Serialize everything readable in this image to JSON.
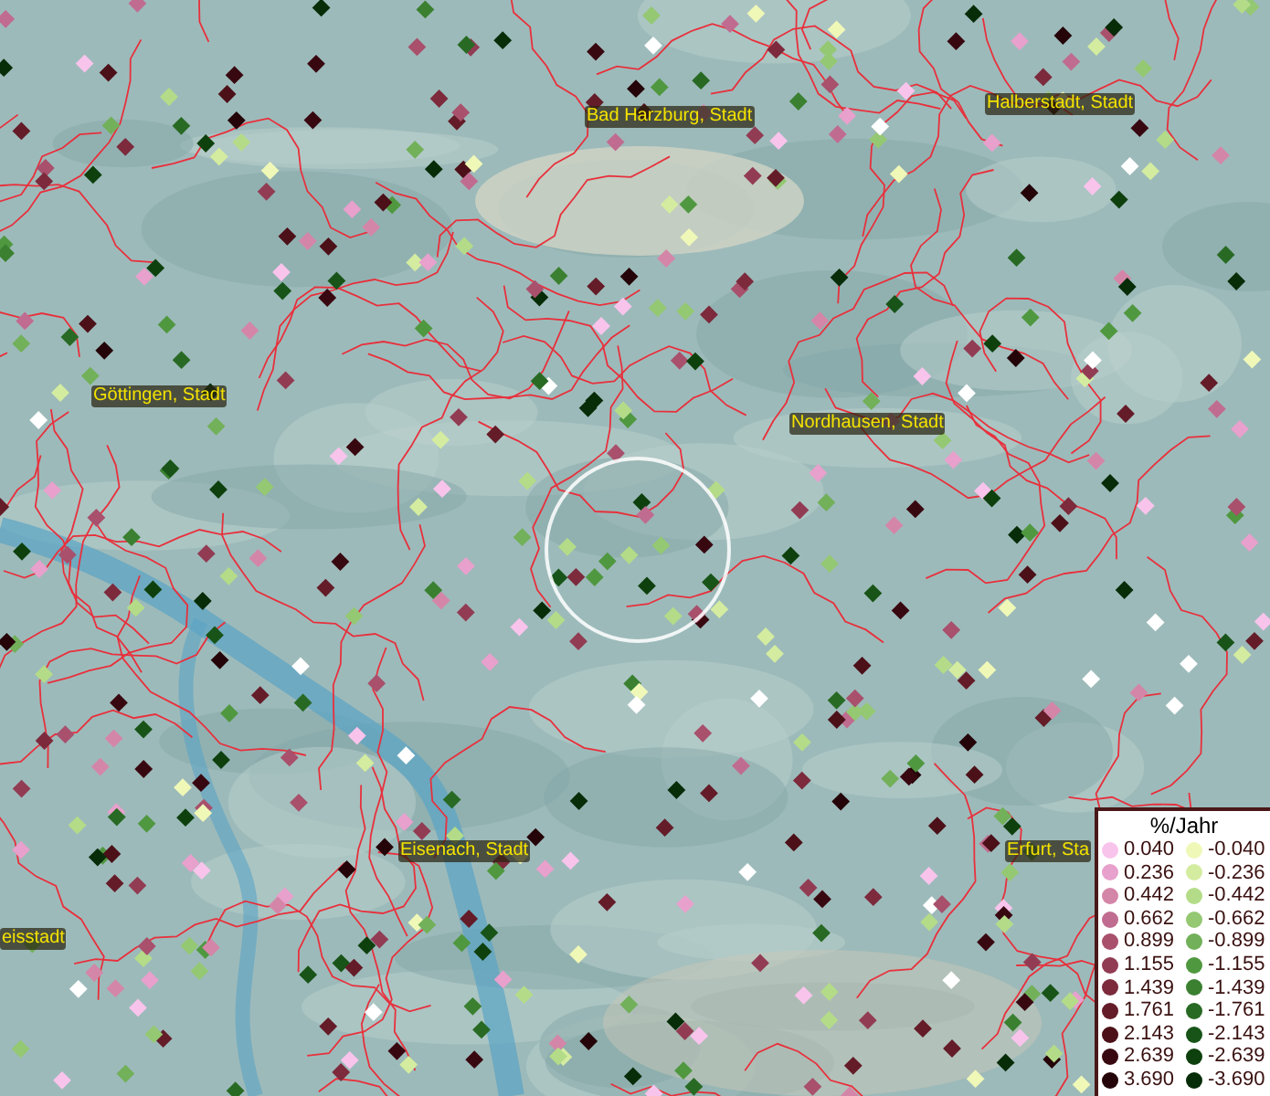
{
  "map": {
    "places": [
      {
        "name": "Bad Harzburg, Stadt"
      },
      {
        "name": "Halberstadt, Stadt"
      },
      {
        "name": "Göttingen, Stadt"
      },
      {
        "name": "Nordhausen, Stadt"
      },
      {
        "name": "Eisenach, Stadt"
      },
      {
        "name": "Erfurt, Sta"
      },
      {
        "name": "eisstadt"
      }
    ]
  },
  "legend": {
    "title": "%/Jahr",
    "entries": [
      {
        "label": "0.040",
        "color": "#f8c4ec"
      },
      {
        "label": "-0.040",
        "color": "#f0f8b8"
      },
      {
        "label": "0.236",
        "color": "#e8a0cc"
      },
      {
        "label": "-0.236",
        "color": "#d4eca0"
      },
      {
        "label": "0.442",
        "color": "#d486a8"
      },
      {
        "label": "-0.442",
        "color": "#b4dc88"
      },
      {
        "label": "0.662",
        "color": "#c06c90"
      },
      {
        "label": "-0.662",
        "color": "#94c872"
      },
      {
        "label": "0.899",
        "color": "#a8506c"
      },
      {
        "label": "-0.899",
        "color": "#72b05a"
      },
      {
        "label": "1.155",
        "color": "#923c54"
      },
      {
        "label": "-1.155",
        "color": "#509840"
      },
      {
        "label": "1.439",
        "color": "#7c2a3c"
      },
      {
        "label": "-1.439",
        "color": "#3a8030"
      },
      {
        "label": "1.761",
        "color": "#641c28"
      },
      {
        "label": "-1.761",
        "color": "#286a24"
      },
      {
        "label": "2.143",
        "color": "#4c1018"
      },
      {
        "label": "-2.143",
        "color": "#185418"
      },
      {
        "label": "2.639",
        "color": "#380810"
      },
      {
        "label": "-2.639",
        "color": "#0e400e"
      },
      {
        "label": "3.690",
        "color": "#240408"
      },
      {
        "label": "-3.690",
        "color": "#062c08"
      }
    ]
  }
}
